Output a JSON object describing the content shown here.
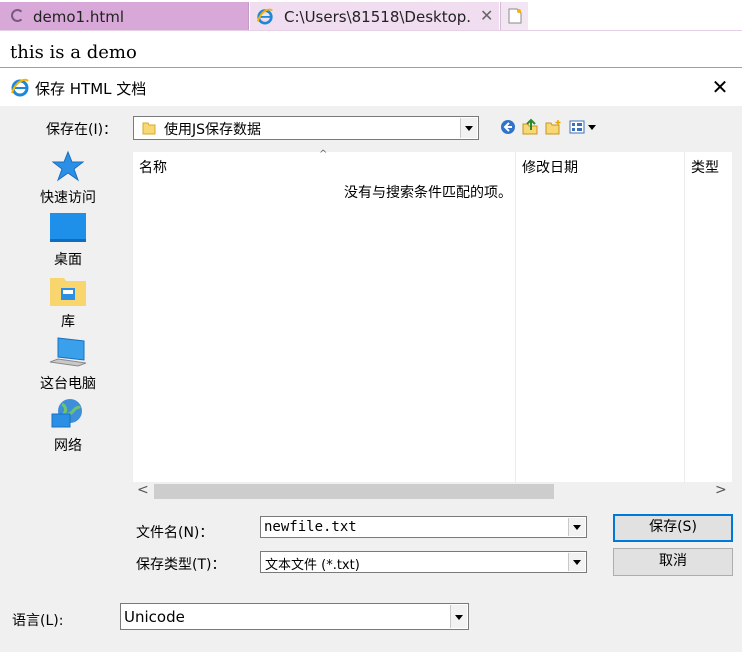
{
  "browser": {
    "tabs": [
      {
        "title": "demo1.html"
      },
      {
        "title": "C:\\Users\\81518\\Desktop..."
      }
    ],
    "page_text": "this is a demo"
  },
  "dialog": {
    "title": "保存 HTML 文档",
    "save_in_label": "保存在(I)：",
    "save_in_value": "使用JS保存数据",
    "places": [
      {
        "label": "快速访问",
        "icon": "star-icon"
      },
      {
        "label": "桌面",
        "icon": "desktop-icon"
      },
      {
        "label": "库",
        "icon": "library-icon"
      },
      {
        "label": "这台电脑",
        "icon": "computer-icon"
      },
      {
        "label": "网络",
        "icon": "network-icon"
      }
    ],
    "columns": [
      "名称",
      "修改日期",
      "类型"
    ],
    "empty_message": "没有与搜索条件匹配的项。",
    "filename_label": "文件名(N)：",
    "filename_value": "newfile.txt",
    "filetype_label": "保存类型(T)：",
    "filetype_value": "文本文件 (*.txt)",
    "save_button": "保存(S)",
    "cancel_button": "取消",
    "language_label": "语言(L):",
    "language_value": "Unicode",
    "close_symbol": "✕"
  },
  "colors": {
    "active_tab": "#d7a8d8",
    "inactive_tab": "#f0ddf0",
    "dialog_bg": "#f0f0f0",
    "accent": "#0078d7"
  }
}
